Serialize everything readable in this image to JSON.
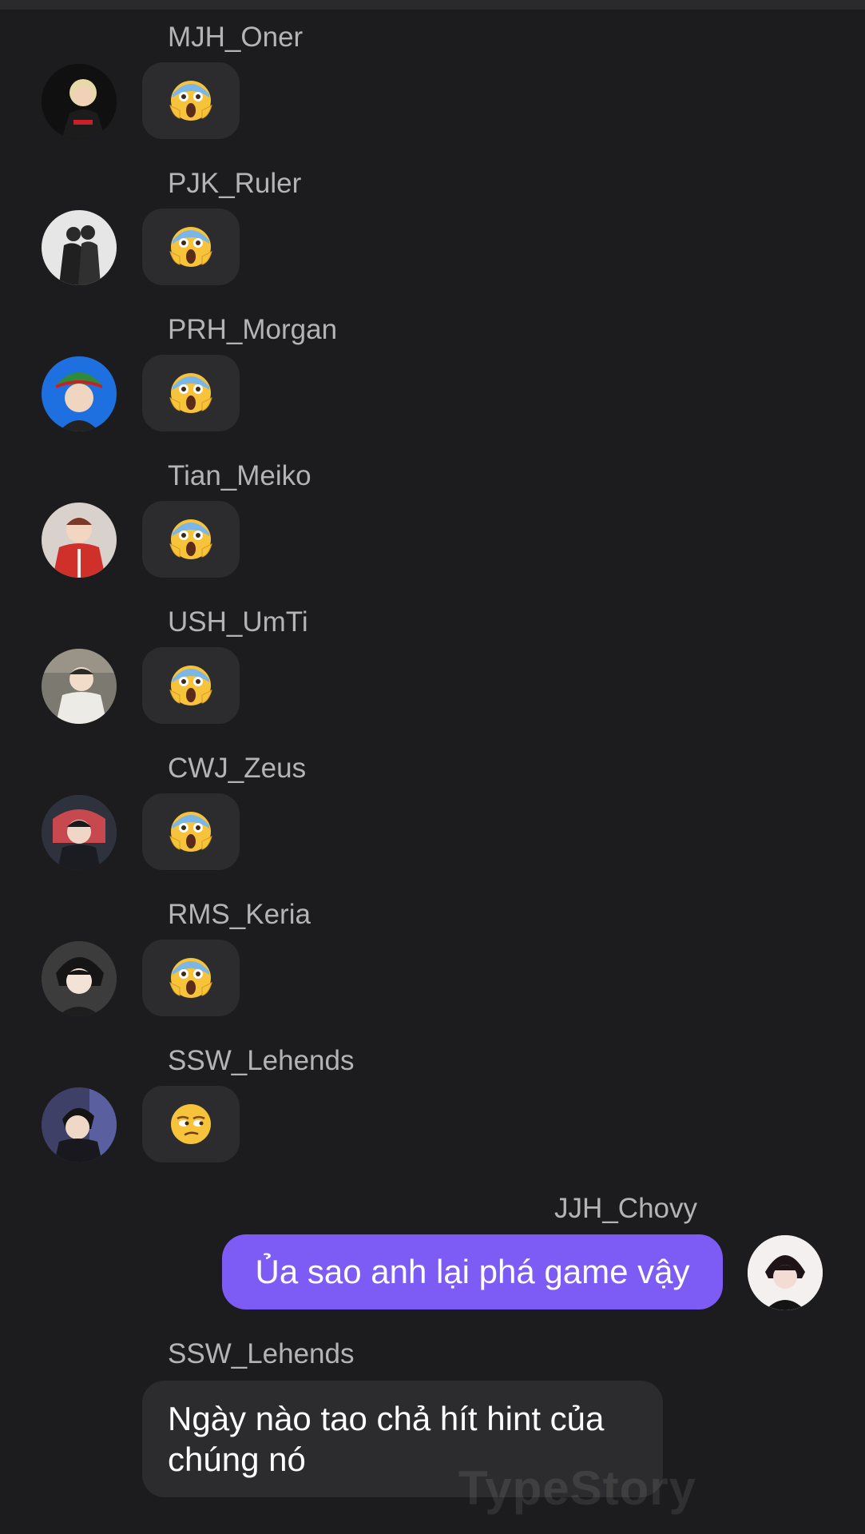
{
  "messages": [
    {
      "sender": "MJH_Oner",
      "emoji": "scream",
      "avatar_color": "#1a1a1a"
    },
    {
      "sender": "PJK_Ruler",
      "emoji": "scream",
      "avatar_color": "#d8d8d8"
    },
    {
      "sender": "PRH_Morgan",
      "emoji": "scream",
      "avatar_color": "#1e6fe0"
    },
    {
      "sender": "Tian_Meiko",
      "emoji": "scream",
      "avatar_color": "#c8342b"
    },
    {
      "sender": "USH_UmTi",
      "emoji": "scream",
      "avatar_color": "#8a8a80"
    },
    {
      "sender": "CWJ_Zeus",
      "emoji": "scream",
      "avatar_color": "#3a3f4a"
    },
    {
      "sender": "RMS_Keria",
      "emoji": "scream",
      "avatar_color": "#444444"
    },
    {
      "sender": "SSW_Lehends",
      "emoji": "unamused",
      "avatar_color": "#4a4a70"
    }
  ],
  "outgoing": {
    "sender": "JJH_Chovy",
    "text": "Ủa sao anh lại phá game vậy",
    "bubble_color": "#7d5cf5"
  },
  "last_message": {
    "sender": "SSW_Lehends",
    "text": "Ngày nào tao chả hít hint của chúng nó"
  },
  "watermark": "TypeStory",
  "colors": {
    "background": "#1c1c1e",
    "bubble": "#2c2c2e",
    "sender_text": "#b3b3b8"
  }
}
